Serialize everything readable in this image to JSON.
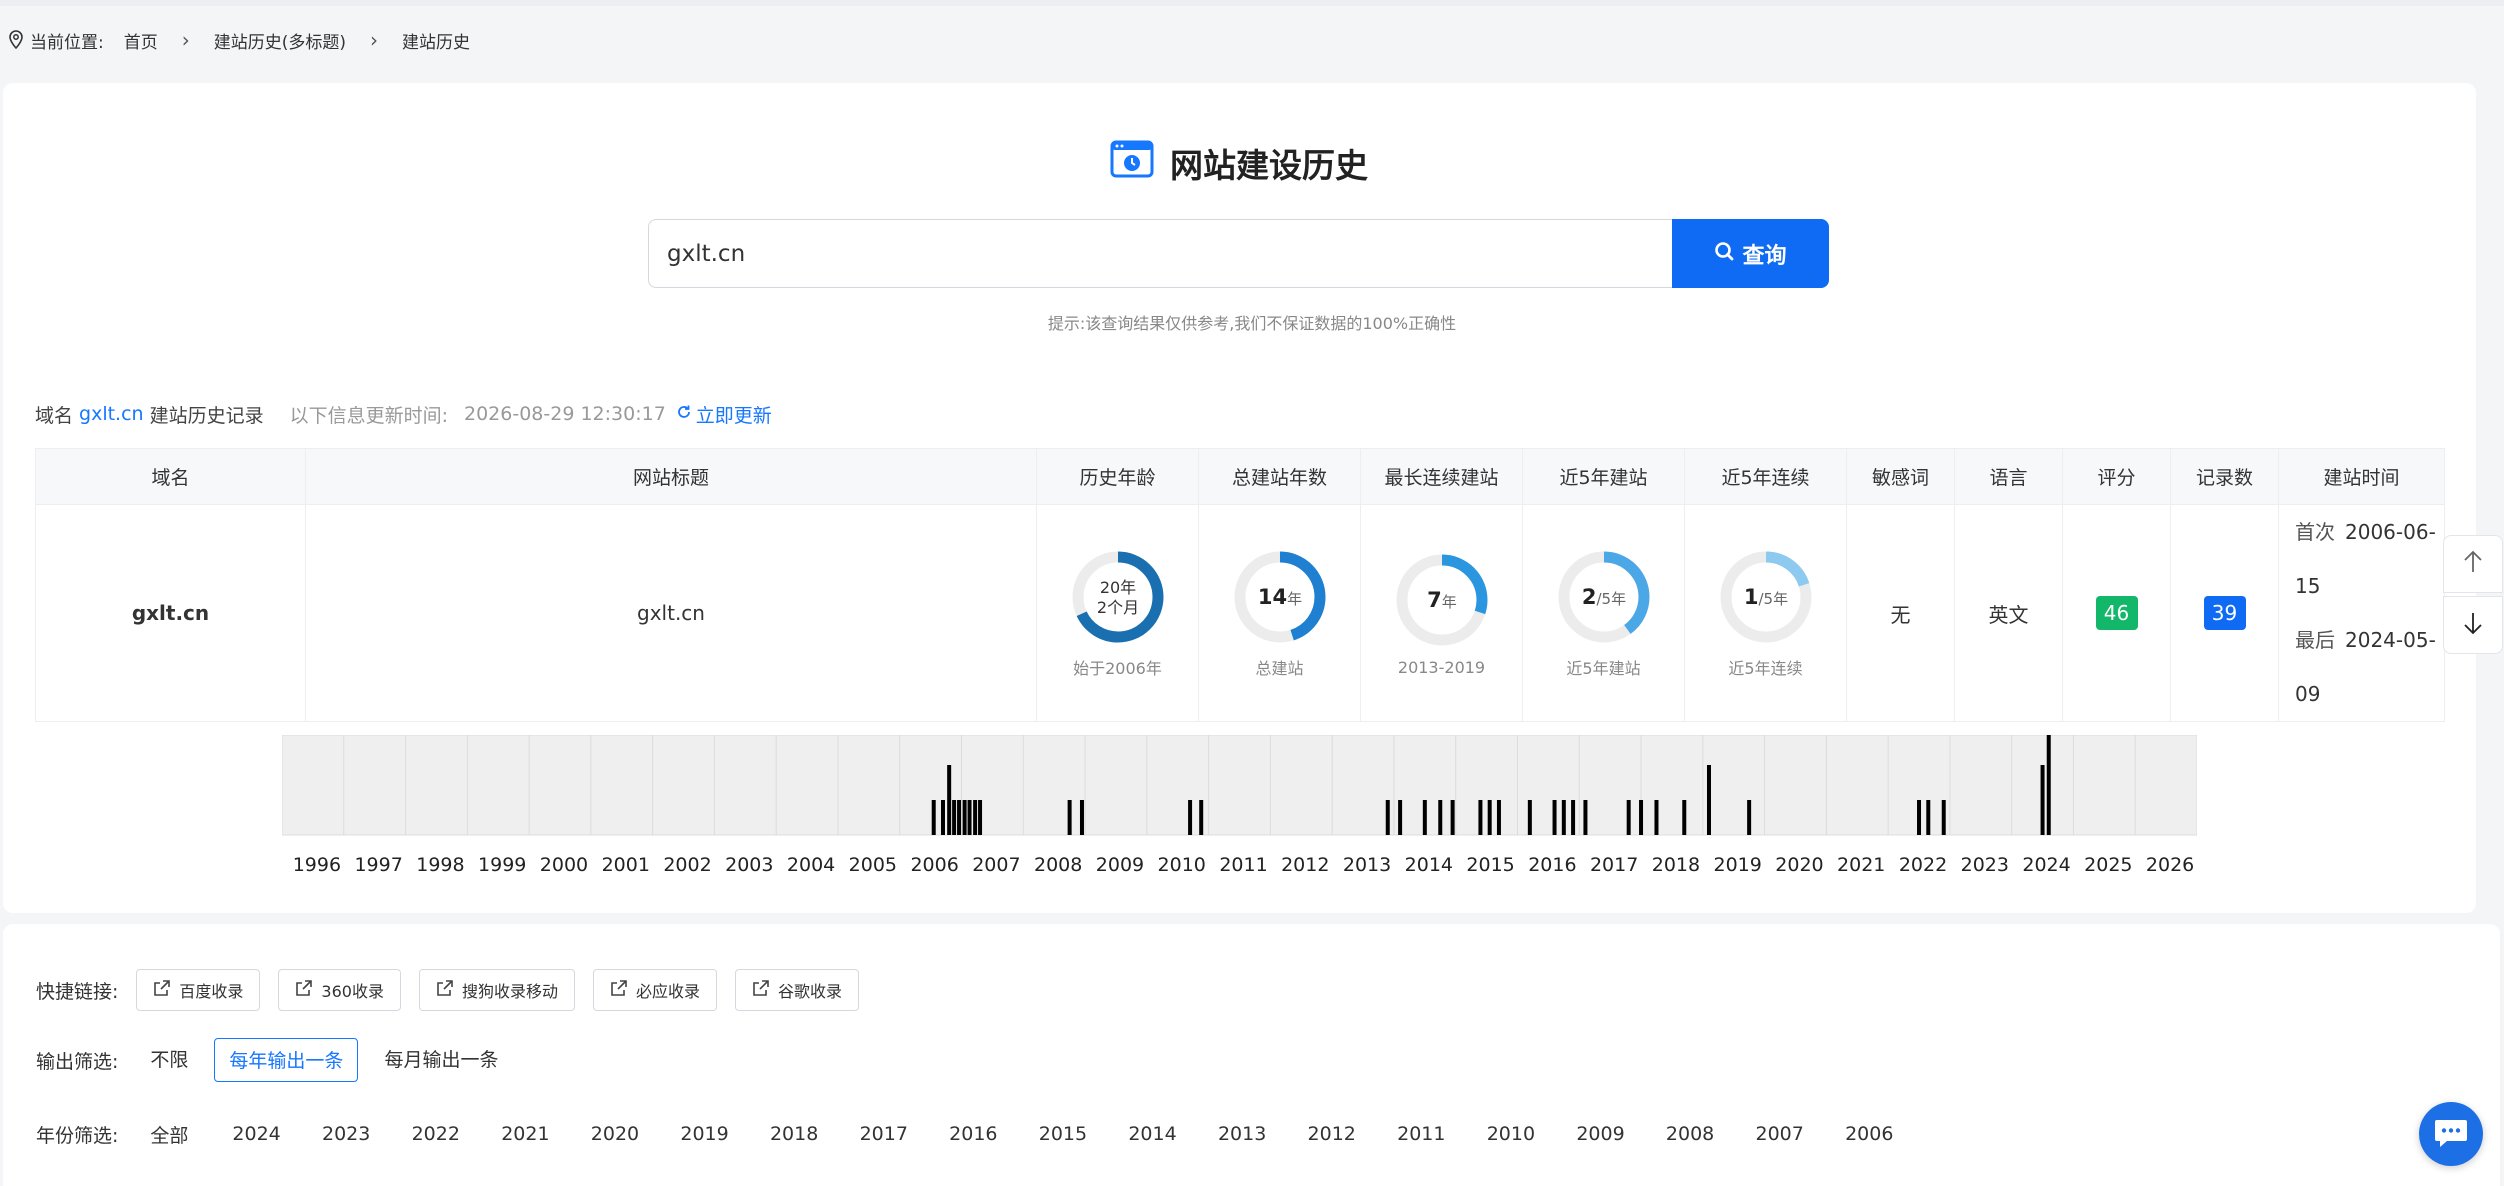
{
  "breadcrumb": {
    "label": "当前位置:",
    "items": [
      "首页",
      "建站历史(多标题)",
      "建站历史"
    ]
  },
  "hero": {
    "title": "网站建设历史"
  },
  "search": {
    "value": "gxlt.cn",
    "placeholder": "",
    "button": "查询"
  },
  "hint": "提示:该查询结果仅供参考,我们不保证数据的100%正确性",
  "record": {
    "prefix": "域名",
    "domain": "gxlt.cn",
    "suffix": "建站历史记录",
    "updated_label": "以下信息更新时间:",
    "updated_time": "2026-08-29 12:30:17",
    "refresh": "立即更新"
  },
  "table": {
    "headers": [
      "域名",
      "网站标题",
      "历史年龄",
      "总建站年数",
      "最长连续建站",
      "近5年建站",
      "近5年连续",
      "敏感词",
      "语言",
      "评分",
      "记录数",
      "建站时间"
    ],
    "row": {
      "domain": "gxlt.cn",
      "title": "gxlt.cn",
      "age": {
        "line1": "20年",
        "line2": "2个月",
        "caption": "始于2006年",
        "fraction": 0.68
      },
      "total": {
        "num": "14",
        "unit": "年",
        "caption": "总建站",
        "fraction": 0.45
      },
      "longest": {
        "num": "7",
        "unit": "年",
        "caption": "2013-2019",
        "fraction": 0.3
      },
      "recent5": {
        "num": "2",
        "unit": "/5年",
        "caption": "近5年建站",
        "fraction": 0.4
      },
      "recent5cont": {
        "num": "1",
        "unit": "/5年",
        "caption": "近5年连续",
        "fraction": 0.2
      },
      "sensitive": "无",
      "language": "英文",
      "score": "46",
      "records": "39",
      "first_label": "首次",
      "first_date": "2006-06-15",
      "last_label": "最后",
      "last_date": "2024-05-09"
    }
  },
  "colors": {
    "age": "#1a6fb0",
    "total": "#1f7fd1",
    "longest": "#2b96e0",
    "recent5": "#4ba7e6",
    "recent5cont": "#8ec9f0",
    "track": "#ececec"
  },
  "chart_data": {
    "type": "bar",
    "x_years": [
      "1996",
      "1997",
      "1998",
      "1999",
      "2000",
      "2001",
      "2002",
      "2003",
      "2004",
      "2005",
      "2006",
      "2007",
      "2008",
      "2009",
      "2010",
      "2011",
      "2012",
      "2013",
      "2014",
      "2015",
      "2016",
      "2017",
      "2018",
      "2019",
      "2020",
      "2021",
      "2022",
      "2023",
      "2024",
      "2025",
      "2026"
    ],
    "records": [
      {
        "t": 2006.05,
        "h": 0.35
      },
      {
        "t": 2006.2,
        "h": 0.35
      },
      {
        "t": 2006.3,
        "h": 0.7
      },
      {
        "t": 2006.38,
        "h": 0.35
      },
      {
        "t": 2006.46,
        "h": 0.35
      },
      {
        "t": 2006.55,
        "h": 0.35
      },
      {
        "t": 2006.63,
        "h": 0.35
      },
      {
        "t": 2006.72,
        "h": 0.35
      },
      {
        "t": 2006.8,
        "h": 0.35
      },
      {
        "t": 2008.25,
        "h": 0.35
      },
      {
        "t": 2008.45,
        "h": 0.35
      },
      {
        "t": 2010.2,
        "h": 0.35
      },
      {
        "t": 2010.38,
        "h": 0.35
      },
      {
        "t": 2013.4,
        "h": 0.35
      },
      {
        "t": 2013.6,
        "h": 0.35
      },
      {
        "t": 2014.0,
        "h": 0.35
      },
      {
        "t": 2014.25,
        "h": 0.35
      },
      {
        "t": 2014.45,
        "h": 0.35
      },
      {
        "t": 2014.9,
        "h": 0.35
      },
      {
        "t": 2015.05,
        "h": 0.35
      },
      {
        "t": 2015.2,
        "h": 0.35
      },
      {
        "t": 2015.7,
        "h": 0.35
      },
      {
        "t": 2016.1,
        "h": 0.35
      },
      {
        "t": 2016.25,
        "h": 0.35
      },
      {
        "t": 2016.4,
        "h": 0.35
      },
      {
        "t": 2016.6,
        "h": 0.35
      },
      {
        "t": 2017.3,
        "h": 0.35
      },
      {
        "t": 2017.5,
        "h": 0.35
      },
      {
        "t": 2017.75,
        "h": 0.35
      },
      {
        "t": 2018.2,
        "h": 0.35
      },
      {
        "t": 2018.6,
        "h": 0.7
      },
      {
        "t": 2019.25,
        "h": 0.35
      },
      {
        "t": 2022.0,
        "h": 0.35
      },
      {
        "t": 2022.15,
        "h": 0.35
      },
      {
        "t": 2022.4,
        "h": 0.35
      },
      {
        "t": 2024.0,
        "h": 0.7
      },
      {
        "t": 2024.1,
        "h": 1.0
      }
    ]
  },
  "quick": {
    "label": "快捷链接:",
    "buttons": [
      "百度收录",
      "360收录",
      "搜狗收录移动",
      "必应收录",
      "谷歌收录"
    ]
  },
  "output": {
    "label": "输出筛选:",
    "options": [
      "不限",
      "每年输出一条",
      "每月输出一条"
    ],
    "active_index": 1
  },
  "years": {
    "label": "年份筛选:",
    "options": [
      "全部",
      "2024",
      "2023",
      "2022",
      "2021",
      "2020",
      "2019",
      "2018",
      "2017",
      "2016",
      "2015",
      "2014",
      "2013",
      "2012",
      "2011",
      "2010",
      "2009",
      "2008",
      "2007",
      "2006"
    ]
  }
}
